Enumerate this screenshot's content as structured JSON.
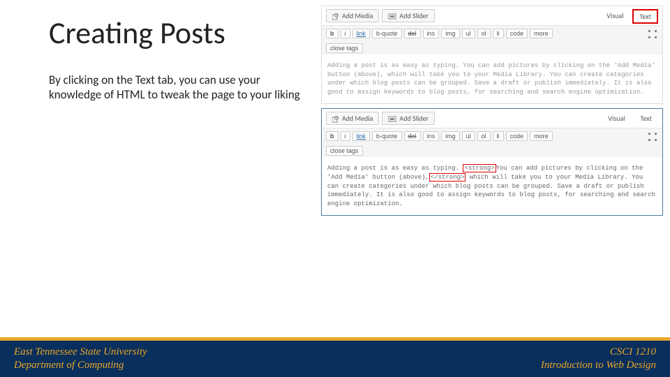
{
  "title": "Creating Posts",
  "body_text": "By clicking on the Text tab, you can use your knowledge of HTML to tweak the page to your liking",
  "editor": {
    "add_media": "Add Media",
    "add_slider": "Add Slider",
    "visual_tab": "Visual",
    "text_tab": "Text",
    "buttons": {
      "b": "b",
      "i": "i",
      "link": "link",
      "bquote": "b-quote",
      "del": "del",
      "ins": "ins",
      "img": "img",
      "ul": "ul",
      "ol": "ol",
      "li": "li",
      "code": "code",
      "more": "more",
      "close": "close tags"
    },
    "content1": "Adding a post is as easy as typing. You can add pictures by clicking on the 'Add Media' button (above), which will take you to your Media Library. You can create categories under which blog posts can be grouped. Save a draft or publish immediately. It is also good to assign keywords to blog posts, for searching and search engine optimization.",
    "content2_pre": "Adding a post is as easy as typing. ",
    "content2_tag_open": "<strong>",
    "content2_mid": "You can add pictures by clicking on the 'Add Media' button (above),",
    "content2_tag_close": "</strong>",
    "content2_post": " which will take you to your Media Library. You can create categories under which blog posts can be grouped. Save a draft or publish immediately. It is also good to assign keywords to blog posts, for searching and search engine optimization."
  },
  "footer": {
    "line1_left": "East Tennessee State University",
    "line2_left": "Department of Computing",
    "line1_right": "CSCI 1210",
    "line2_right": "Introduction to Web Design"
  }
}
